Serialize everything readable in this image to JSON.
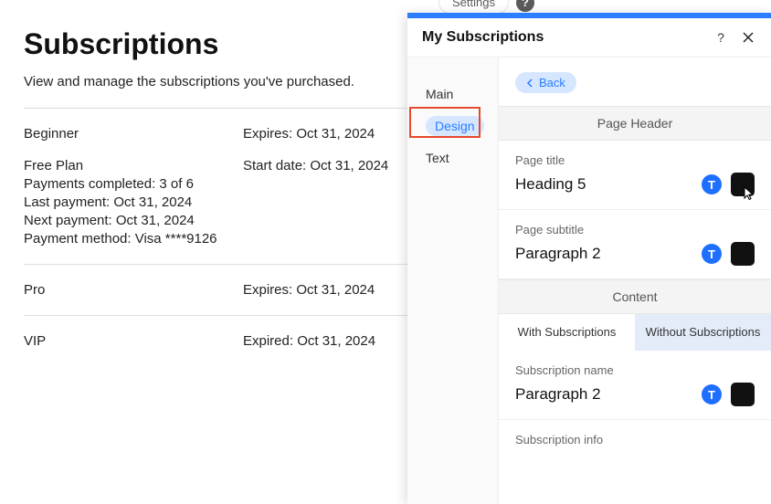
{
  "topbar": {
    "settings": "Settings",
    "help": "?"
  },
  "page": {
    "title": "Subscriptions",
    "subtitle": "View and manage the subscriptions you've purchased.",
    "subs": [
      {
        "name": "Beginner",
        "date_label": "Expires: Oct 31, 2024",
        "details": []
      },
      {
        "name": "Free Plan",
        "date_label": "Start date: Oct 31, 2024",
        "details": [
          "Payments completed: 3 of 6",
          "Last payment: Oct 31, 2024",
          "Next payment: Oct 31, 2024",
          "Payment method: Visa ****9126"
        ]
      },
      {
        "name": "Pro",
        "date_label": "Expires: Oct 31, 2024",
        "details": []
      },
      {
        "name": "VIP",
        "date_label": "Expired: Oct 31, 2024",
        "details": []
      }
    ]
  },
  "panel": {
    "title": "My Subscriptions",
    "help": "?",
    "sidebar": {
      "main": "Main",
      "design": "Design",
      "text": "Text"
    },
    "back": "Back",
    "section_header1": "Page Header",
    "page_title_label": "Page title",
    "page_title_value": "Heading 5",
    "page_subtitle_label": "Page subtitle",
    "page_subtitle_value": "Paragraph 2",
    "t_badge": "T",
    "section_header2": "Content",
    "tab_with": "With Subscriptions",
    "tab_without": "Without Subscriptions",
    "sub_name_label": "Subscription name",
    "sub_name_value": "Paragraph 2",
    "sub_info_label": "Subscription info"
  }
}
